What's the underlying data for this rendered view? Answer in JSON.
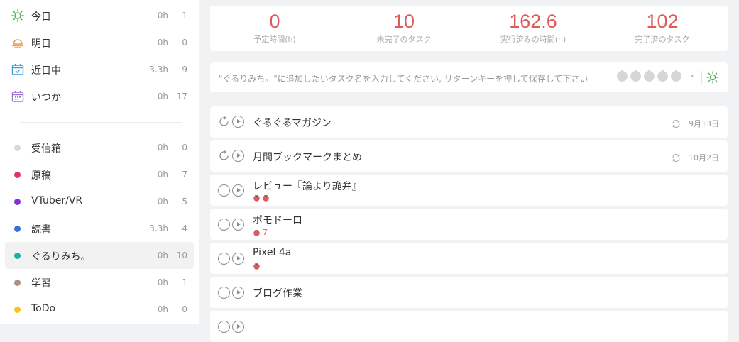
{
  "sidebar": {
    "smart_lists": [
      {
        "label": "今日",
        "hours": "0h",
        "count": "1",
        "icon": "sun-icon",
        "color": "#4caf50"
      },
      {
        "label": "明日",
        "hours": "0h",
        "count": "0",
        "icon": "sunrise-icon",
        "color": "#f39c40"
      },
      {
        "label": "近日中",
        "hours": "3.3h",
        "count": "9",
        "icon": "calendar-check-icon",
        "color": "#3b99d6"
      },
      {
        "label": "いつか",
        "hours": "0h",
        "count": "17",
        "icon": "calendar-icon",
        "color": "#9b6ed3"
      }
    ],
    "projects": [
      {
        "label": "受信箱",
        "hours": "0h",
        "count": "0",
        "color": "#d8d8d8"
      },
      {
        "label": "原稿",
        "hours": "0h",
        "count": "7",
        "color": "#e0306e"
      },
      {
        "label": "VTuber/VR",
        "hours": "0h",
        "count": "5",
        "color": "#8a2be2"
      },
      {
        "label": "読書",
        "hours": "3.3h",
        "count": "4",
        "color": "#3b6fe0"
      },
      {
        "label": "ぐるりみち。",
        "hours": "0h",
        "count": "10",
        "color": "#1ab3a3",
        "active": true
      },
      {
        "label": "学習",
        "hours": "0h",
        "count": "1",
        "color": "#b08e84"
      },
      {
        "label": "ToDo",
        "hours": "0h",
        "count": "0",
        "color": "#f5c518"
      }
    ]
  },
  "stats": [
    {
      "value": "0",
      "label": "予定時間(h)"
    },
    {
      "value": "10",
      "label": "未完了のタスク"
    },
    {
      "value": "162.6",
      "label": "実行済みの時間(h)"
    },
    {
      "value": "102",
      "label": "完了済のタスク"
    }
  ],
  "add_task": {
    "placeholder": "\"ぐるりみち。\"に追加したいタスク名を入力してください, リターンキーを押して保存して下さい",
    "chevron": "›"
  },
  "tasks": [
    {
      "title": "ぐるぐるマガジン",
      "date": "9月13日",
      "repeat": true
    },
    {
      "title": "月間ブックマークまとめ",
      "date": "10月2日",
      "repeat": true
    },
    {
      "title": "レビュー『論より詭弁』",
      "pomodoros": 2,
      "pomo_label": ""
    },
    {
      "title": "ポモドーロ",
      "pomodoros": 1,
      "pomo_label": "7"
    },
    {
      "title": "Pixel 4a",
      "pomodoros": 1,
      "pomo_label": ""
    },
    {
      "title": "ブログ作業"
    },
    {
      "title": ""
    }
  ],
  "colors": {
    "accent": "#e15a5a",
    "sun": "#4caf50"
  }
}
